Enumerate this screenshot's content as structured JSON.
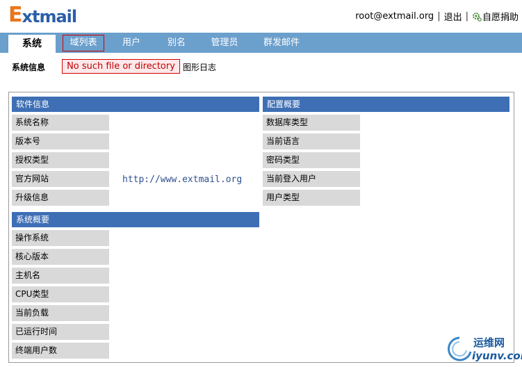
{
  "header": {
    "logo_first": "E",
    "logo_rest": "xtmail",
    "user": "root@extmail.org",
    "separator": "|",
    "logout": "退出",
    "donate": "自愿捐助"
  },
  "nav": {
    "tabs": [
      {
        "label": "系统"
      },
      {
        "label": "域列表"
      },
      {
        "label": "用户"
      },
      {
        "label": "别名"
      },
      {
        "label": "管理员"
      },
      {
        "label": "群发邮件"
      }
    ]
  },
  "subnav": {
    "label": "系统信息",
    "error": "No such file or directory",
    "link": "图形日志"
  },
  "software": {
    "title": "软件信息",
    "rows": [
      "系统名称",
      "版本号",
      "授权类型",
      "官方网站",
      "升级信息"
    ],
    "website_value": "http://www.extmail.org"
  },
  "config": {
    "title": "配置概要",
    "rows": [
      "数据库类型",
      "当前语言",
      "密码类型",
      "当前登入用户",
      "用户类型"
    ]
  },
  "system": {
    "title": "系统概要",
    "rows": [
      "操作系统",
      "核心版本",
      "主机名",
      "CPU类型",
      "当前负载",
      "已运行时间",
      "终端用户数"
    ]
  },
  "watermark": {
    "line1": "运维网",
    "line2": "iyunv.com"
  },
  "colors": {
    "accent": "#6b9fcc",
    "section": "#3e6fb5",
    "error": "#d00000"
  }
}
